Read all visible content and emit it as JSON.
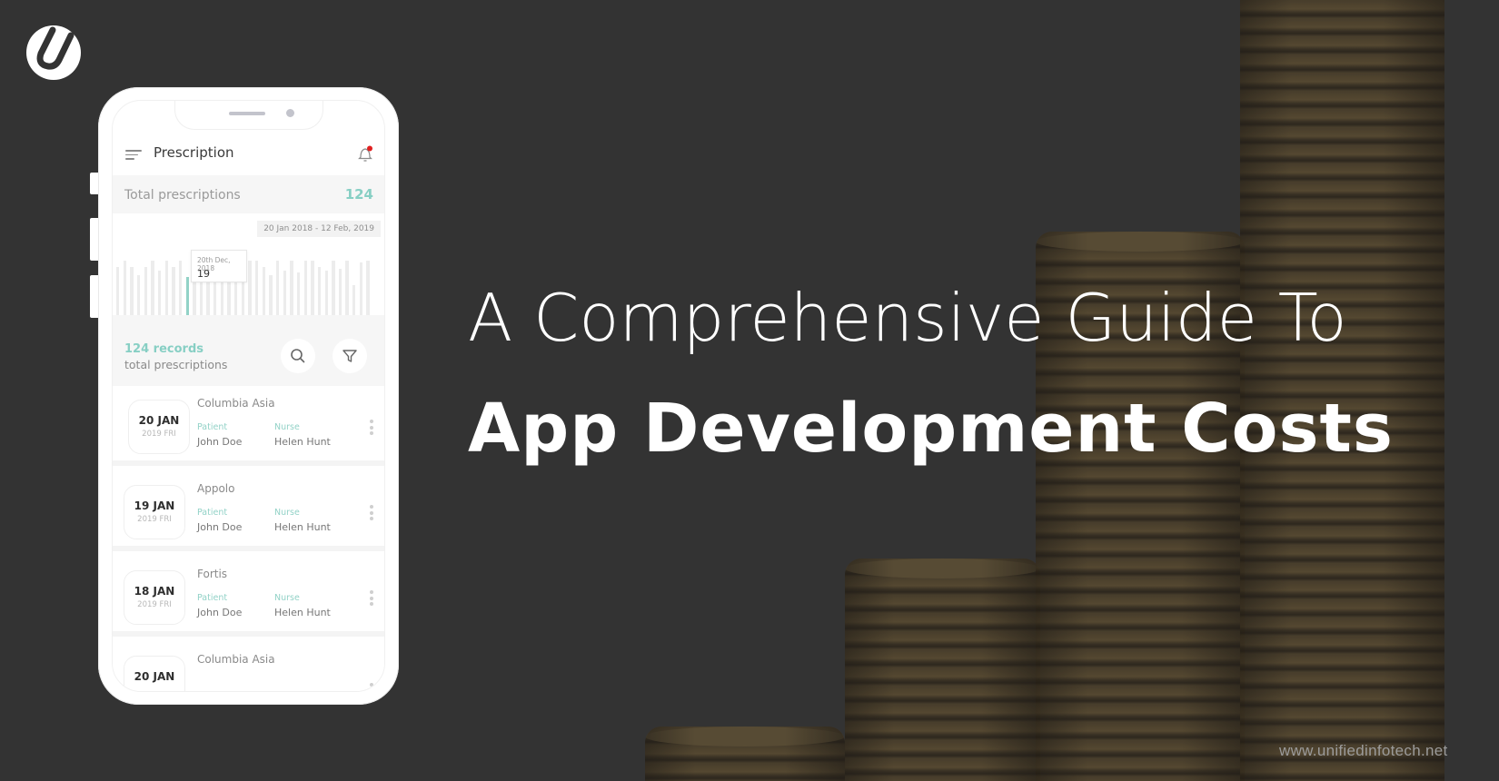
{
  "brand": {
    "logo_icon": "unified-infotech-u-logo",
    "watermark": "www.unifiedinfotech.net"
  },
  "headline": {
    "line1": "A Comprehensive Guide To",
    "line2": "App Development Costs"
  },
  "colors": {
    "background": "#333333",
    "accent_teal": "#87cfc4",
    "notification_dot": "#e02020",
    "text_white": "#ffffff"
  },
  "phone": {
    "app_title": "Prescription",
    "menu_icon": "hamburger-menu-icon",
    "bell_icon": "notification-bell-icon",
    "total_label": "Total prescriptions",
    "total_value": "124",
    "date_range": "20 Jan 2018 - 12 Feb, 2019",
    "tooltip": {
      "date": "20th Dec, 2018",
      "value": "19"
    },
    "records_count": "124 records",
    "records_sub": "total prescriptions",
    "search_icon": "search-icon",
    "filter_icon": "filter-icon",
    "list": [
      {
        "date": "20 JAN",
        "sub": "2019 FRI",
        "hospital": "Columbia Asia",
        "patient_label": "Patient",
        "patient": "John Doe",
        "nurse_label": "Nurse",
        "nurse": "Helen Hunt"
      },
      {
        "date": "19 JAN",
        "sub": "2019 FRI",
        "hospital": "Appolo",
        "patient_label": "Patient",
        "patient": "John Doe",
        "nurse_label": "Nurse",
        "nurse": "Helen Hunt"
      },
      {
        "date": "18 JAN",
        "sub": "2019 FRI",
        "hospital": "Fortis",
        "patient_label": "Patient",
        "patient": "John Doe",
        "nurse_label": "Nurse",
        "nurse": "Helen Hunt"
      },
      {
        "date": "20 JAN",
        "sub": "",
        "hospital": "Columbia Asia",
        "patient_label": "",
        "patient": "",
        "nurse_label": "",
        "nurse": ""
      }
    ]
  },
  "chart_data": {
    "type": "bar",
    "title": "",
    "xlabel": "",
    "ylabel": "",
    "ylim": [
      0,
      30
    ],
    "highlight_index": 10,
    "values": [
      24,
      27,
      24,
      20,
      24,
      27,
      22,
      27,
      24,
      27,
      19,
      27,
      16,
      27,
      27,
      27,
      27,
      18,
      27,
      27,
      27,
      24,
      20,
      27,
      22,
      27,
      21,
      27,
      27,
      24,
      22,
      27,
      23,
      27,
      15,
      26,
      27
    ]
  }
}
